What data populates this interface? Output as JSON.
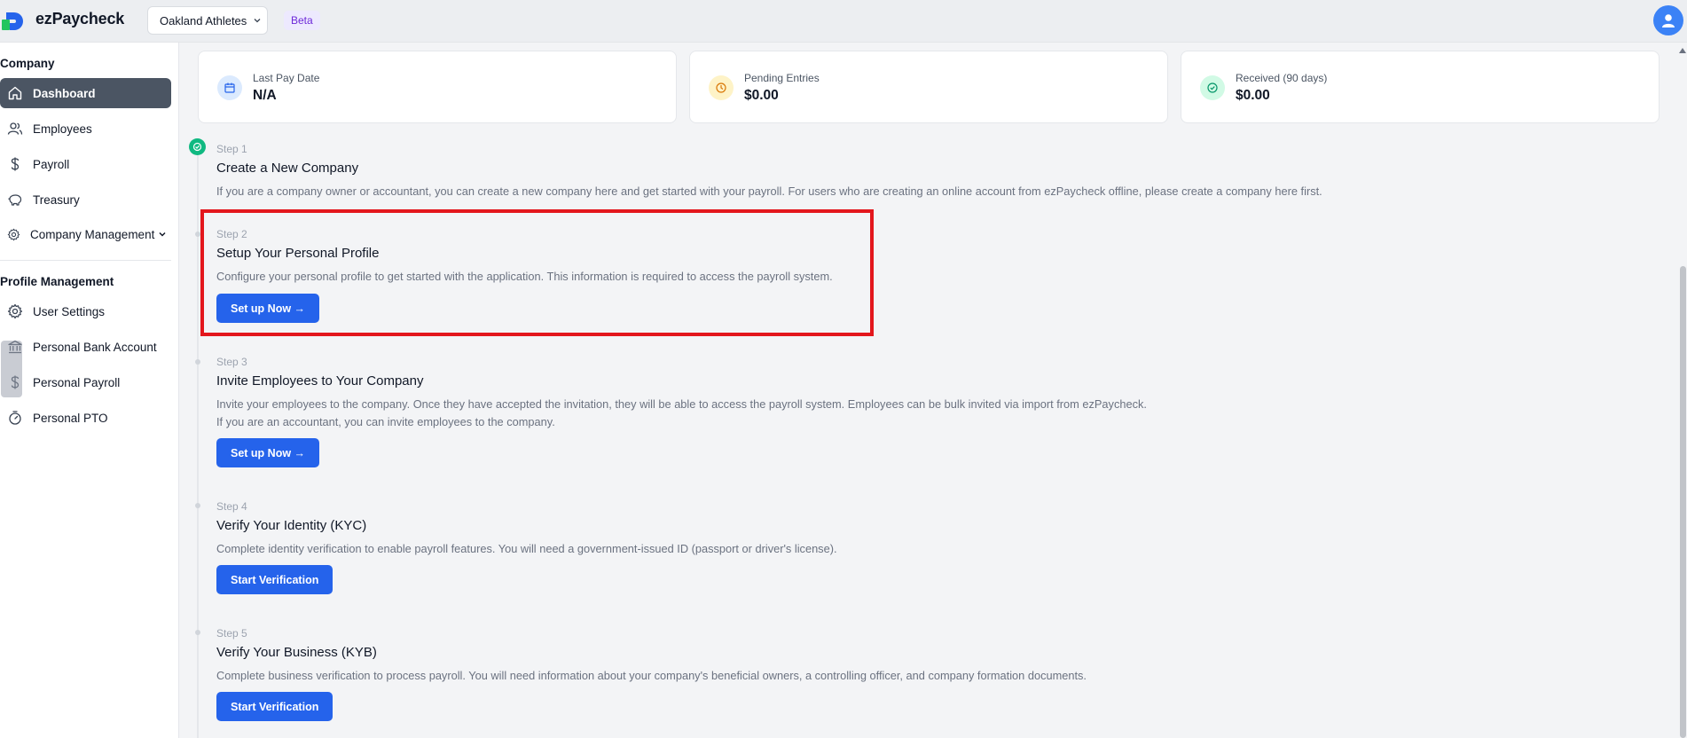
{
  "app": {
    "brand": "ezPaycheck",
    "company": "Oakland Athletes",
    "beta": "Beta"
  },
  "sidebar": {
    "company_title": "Company",
    "company_items": [
      {
        "label": "Dashboard",
        "icon": "home-icon",
        "active": true
      },
      {
        "label": "Employees",
        "icon": "users-icon"
      },
      {
        "label": "Payroll",
        "icon": "dollar-icon"
      },
      {
        "label": "Treasury",
        "icon": "piggy-bank-icon"
      },
      {
        "label": "Company Management",
        "icon": "gear-icon"
      }
    ],
    "profile_title": "Profile Management",
    "profile_items": [
      {
        "label": "User Settings",
        "icon": "gear-icon"
      },
      {
        "label": "Personal Bank Account",
        "icon": "bank-icon"
      },
      {
        "label": "Personal Payroll",
        "icon": "dollar-icon"
      },
      {
        "label": "Personal PTO",
        "icon": "stopwatch-icon"
      }
    ]
  },
  "stats": [
    {
      "label": "Last Pay Date",
      "value": "N/A",
      "icon": "calendar-icon",
      "color": "#dbeafe"
    },
    {
      "label": "Pending Entries",
      "value": "$0.00",
      "icon": "clock-icon",
      "color": "#fef3c7"
    },
    {
      "label": "Received (90 days)",
      "value": "$0.00",
      "icon": "check-circle-icon",
      "color": "#d1fae5"
    }
  ],
  "steps": [
    {
      "num": "Step 1",
      "title": "Create a New Company",
      "desc": [
        "If you are a company owner or accountant, you can create a new company here and get started with your payroll. For users who are creating an online account from ezPaycheck offline, please create a company here first."
      ],
      "done": true
    },
    {
      "num": "Step 2",
      "title": "Setup Your Personal Profile",
      "desc": [
        "Configure your personal profile to get started with the application. This information is required to access the payroll system."
      ],
      "button": "Set up Now →"
    },
    {
      "num": "Step 3",
      "title": "Invite Employees to Your Company",
      "desc": [
        "Invite your employees to the company. Once they have accepted the invitation, they will be able to access the payroll system. Employees can be bulk invited via import from ezPaycheck.",
        "If you are an accountant, you can invite employees to the company."
      ],
      "button": "Set up Now →"
    },
    {
      "num": "Step 4",
      "title": "Verify Your Identity (KYC)",
      "desc": [
        "Complete identity verification to enable payroll features. You will need a government-issued ID (passport or driver's license)."
      ],
      "button": "Start Verification"
    },
    {
      "num": "Step 5",
      "title": "Verify Your Business (KYB)",
      "desc": [
        "Complete business verification to process payroll. You will need information about your company's beneficial owners, a controlling officer, and company formation documents."
      ],
      "button": "Start Verification"
    }
  ],
  "colors": {
    "accent": "#2563eb",
    "sidebar_active": "#4b5563",
    "highlight": "#e3161c"
  }
}
